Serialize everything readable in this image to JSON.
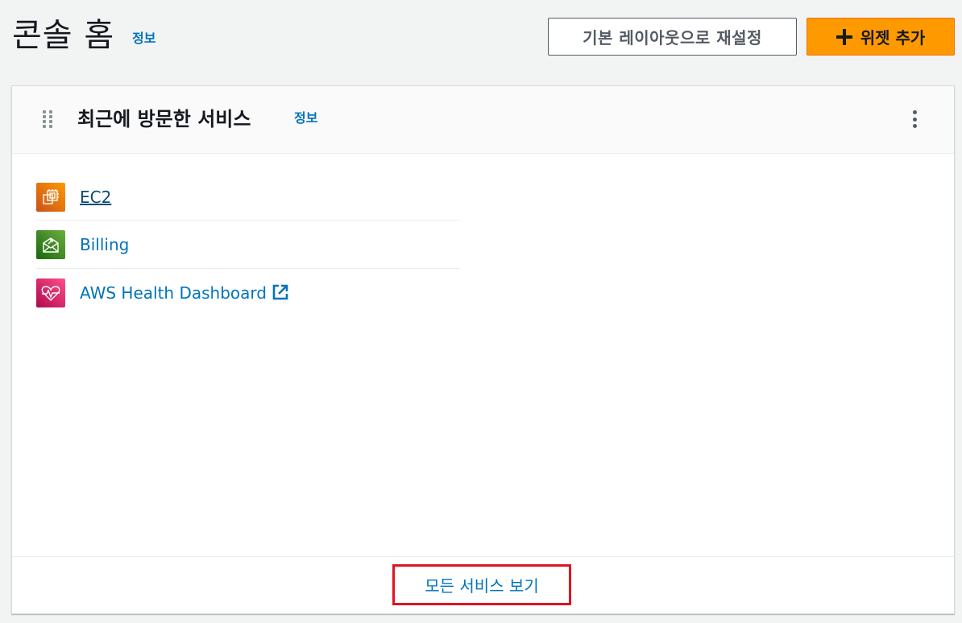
{
  "header": {
    "title": "콘솔 홈",
    "info_link": "정보",
    "reset_button": "기본 레이아웃으로 재설정",
    "add_widget_button": "위젯 추가"
  },
  "widget": {
    "title": "최근에 방문한 서비스",
    "info_link": "정보",
    "services": [
      {
        "label": "EC2",
        "icon": "ec2-icon",
        "color": "#e7700e"
      },
      {
        "label": "Billing",
        "icon": "billing-icon",
        "color": "#3f8624"
      },
      {
        "label": "AWS Health Dashboard",
        "icon": "health-icon",
        "color": "#cc2264",
        "external": true
      }
    ],
    "view_all_link": "모든 서비스 보기"
  },
  "colors": {
    "accent": "#ff9900",
    "link": "#0073bb",
    "highlight_border": "#e0141e"
  }
}
